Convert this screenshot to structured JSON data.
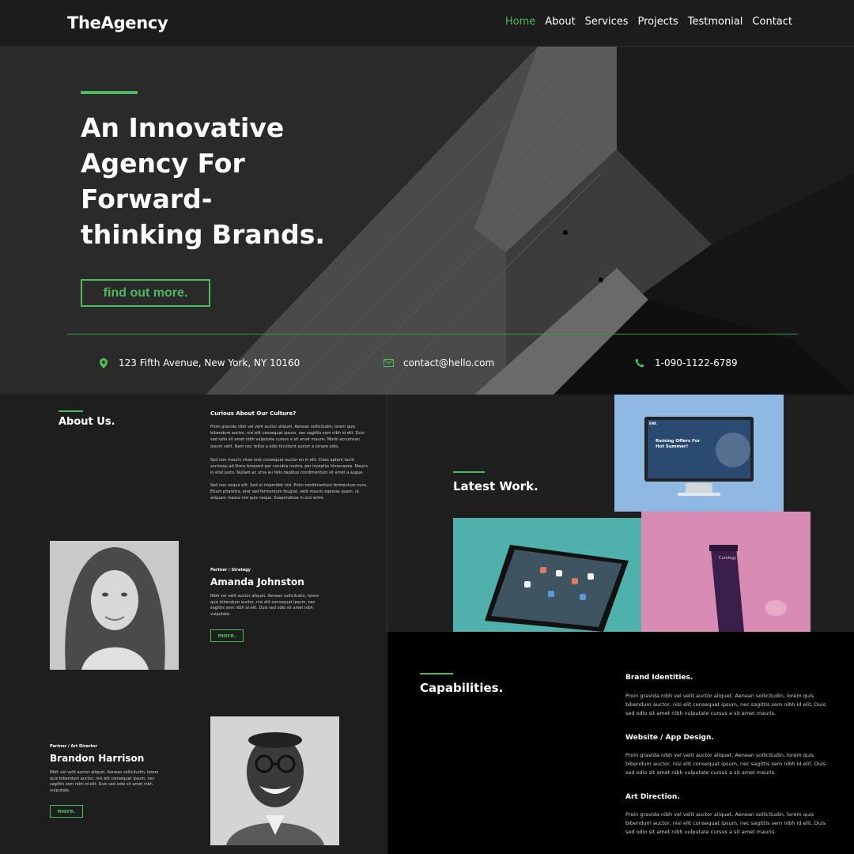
{
  "nav": {
    "logo": "TheAgency",
    "links": [
      {
        "label": "Home",
        "active": true
      },
      {
        "label": "About"
      },
      {
        "label": "Services"
      },
      {
        "label": "Projects"
      },
      {
        "label": "Testmonial"
      },
      {
        "label": "Contact"
      }
    ]
  },
  "hero": {
    "title": "An Innovative Agency For Forward-thinking Brands.",
    "cta": "find out more.",
    "contacts": [
      {
        "icon": "map-pin-icon",
        "text": "123 Fifth Avenue, New York, NY 10160"
      },
      {
        "icon": "mail-icon",
        "text": "contact@hello.com"
      },
      {
        "icon": "phone-icon",
        "text": "1-090-1122-6789"
      }
    ]
  },
  "about": {
    "title": "About Us.",
    "subtitle": "Curious About Our Culture?",
    "paragraphs": [
      "Proin gravida nibh vel velit auctor aliquet. Aenean sollicitudin, lorem quis bibendum auctor, nisi elit consequat ipsum, nec sagittis sem nibh id elit. Duis sed odio sit amet nibh vulputate cursus a sit amet mauris. Morbi accumsan ipsum velit. Nam nec tellus a odio tincidunt auctor a ornare odio.",
      "Sed non mauris vitae erat consequat auctor eu in elit. Class aptent taciti sociosqu ad litora torquent per conubia nostra, per inceptos himenaeos. Mauris in erat justo. Nullam ac urna eu felis dapibus condimentum sit amet a augue.",
      "Sed non neque elit. Sed ut imperdiet nisi. Proin condimentum fermentum nunc. Etiam pharetra, erat sed fermentum feugiat, velit mauris egestas quam, ut aliquam massa nisl quis neque. Suspendisse in orci enim."
    ]
  },
  "team": [
    {
      "role": "Partner / Strategy",
      "name": "Amanda Johnston",
      "bio": "Nibh vel velit auctor aliquet. Aenean sollicitudin, lorem quis bibendum auctor, nisi elit consequat ipsum, nec sagittis sem nibh id elit. Duis sed odio sit amet nibh vulputate.",
      "more": "more."
    },
    {
      "role": "Partner / Art Director",
      "name": "Brandon Harrison",
      "bio": "Nibh vel velit auctor aliquet. Aenean sollicitudin, lorem quis bibendum auctor, nisi elit consequat ipsum, nec sagittis sem nibh id elit. Duis sed odio sit amet nibh vulputate.",
      "more": "more."
    }
  ],
  "work": {
    "title": "Latest Work.",
    "monitor_brand": "ENK",
    "monitor_headline": "Raining Offers For Hot Summer!",
    "tube_brand": "Curology"
  },
  "capabilities": {
    "title": "Capabilities.",
    "items": [
      {
        "heading": "Brand Identities.",
        "text": "Proin gravida nibh vel velit auctor aliquet. Aenean sollicitudin, lorem quis bibendum auctor, nisi elit consequat ipsum, nec sagittis sem nibh id elit. Duis sed odio sit amet nibh vulputate cursus a sit amet mauris."
      },
      {
        "heading": "Website / App Design.",
        "text": "Proin gravida nibh vel velit auctor aliquet. Aenean sollicitudin, lorem quis bibendum auctor, nisi elit consequat ipsum, nec sagittis sem nibh id elit. Duis sed odio sit amet nibh vulputate cursus a sit amet mauris."
      },
      {
        "heading": "Art Direction.",
        "text": "Proin gravida nibh vel velit auctor aliquet. Aenean sollicitudin, lorem quis bibendum auctor, nisi elit consequat ipsum, nec sagittis sem nibh id elit. Duis sed odio sit amet nibh vulputate cursus a sit amet mauris."
      }
    ]
  },
  "colors": {
    "accent": "#4cbb5d",
    "background": "#1e1e1e",
    "dark": "#000000"
  }
}
